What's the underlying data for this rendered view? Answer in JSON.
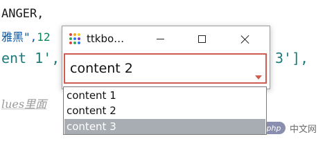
{
  "editor": {
    "line1": "ANGER,",
    "line2_text": "雅黑\",",
    "line2_num": "12",
    "line3_left": "ent 1',",
    "line3_right": "3'],",
    "line4": "lues里面"
  },
  "window": {
    "title": "ttkbo…",
    "combobox_value": "content 2",
    "options": [
      "content 1",
      "content 2",
      "content 3"
    ],
    "highlighted_option": "content 3"
  },
  "watermark": {
    "logo": "php",
    "text": "中文网"
  },
  "colors": {
    "focus_border": "#cf5b52",
    "selection": "#a8adb3"
  }
}
